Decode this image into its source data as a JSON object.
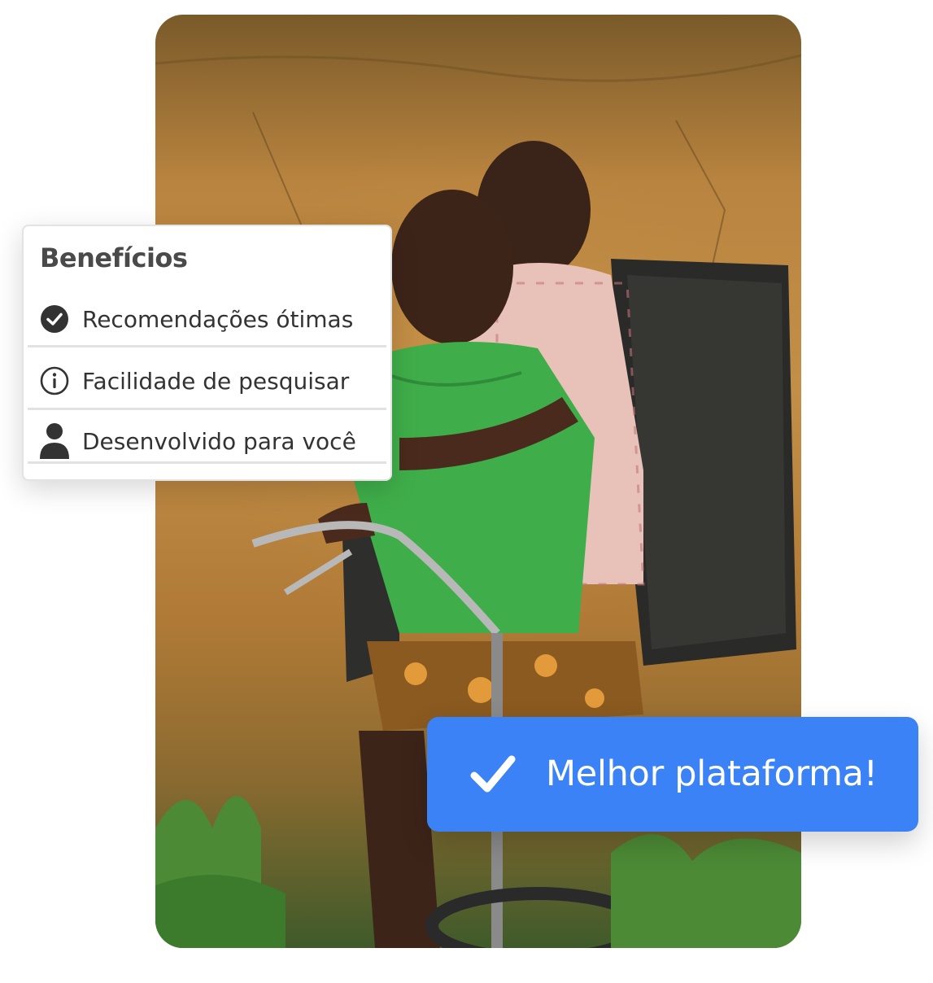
{
  "benefits": {
    "title": "Benefícios",
    "items": [
      {
        "icon": "check-circle-icon",
        "label": "Recomendações ótimas"
      },
      {
        "icon": "info-circle-icon",
        "label": "Facilidade de pesquisar"
      },
      {
        "icon": "user-icon",
        "label": "Desenvolvido para você"
      }
    ]
  },
  "cta": {
    "icon": "checkmark-icon",
    "label": "Melhor plataforma!"
  },
  "colors": {
    "accent": "#3b82f6",
    "text": "#333333",
    "title": "#4a4a4a"
  }
}
